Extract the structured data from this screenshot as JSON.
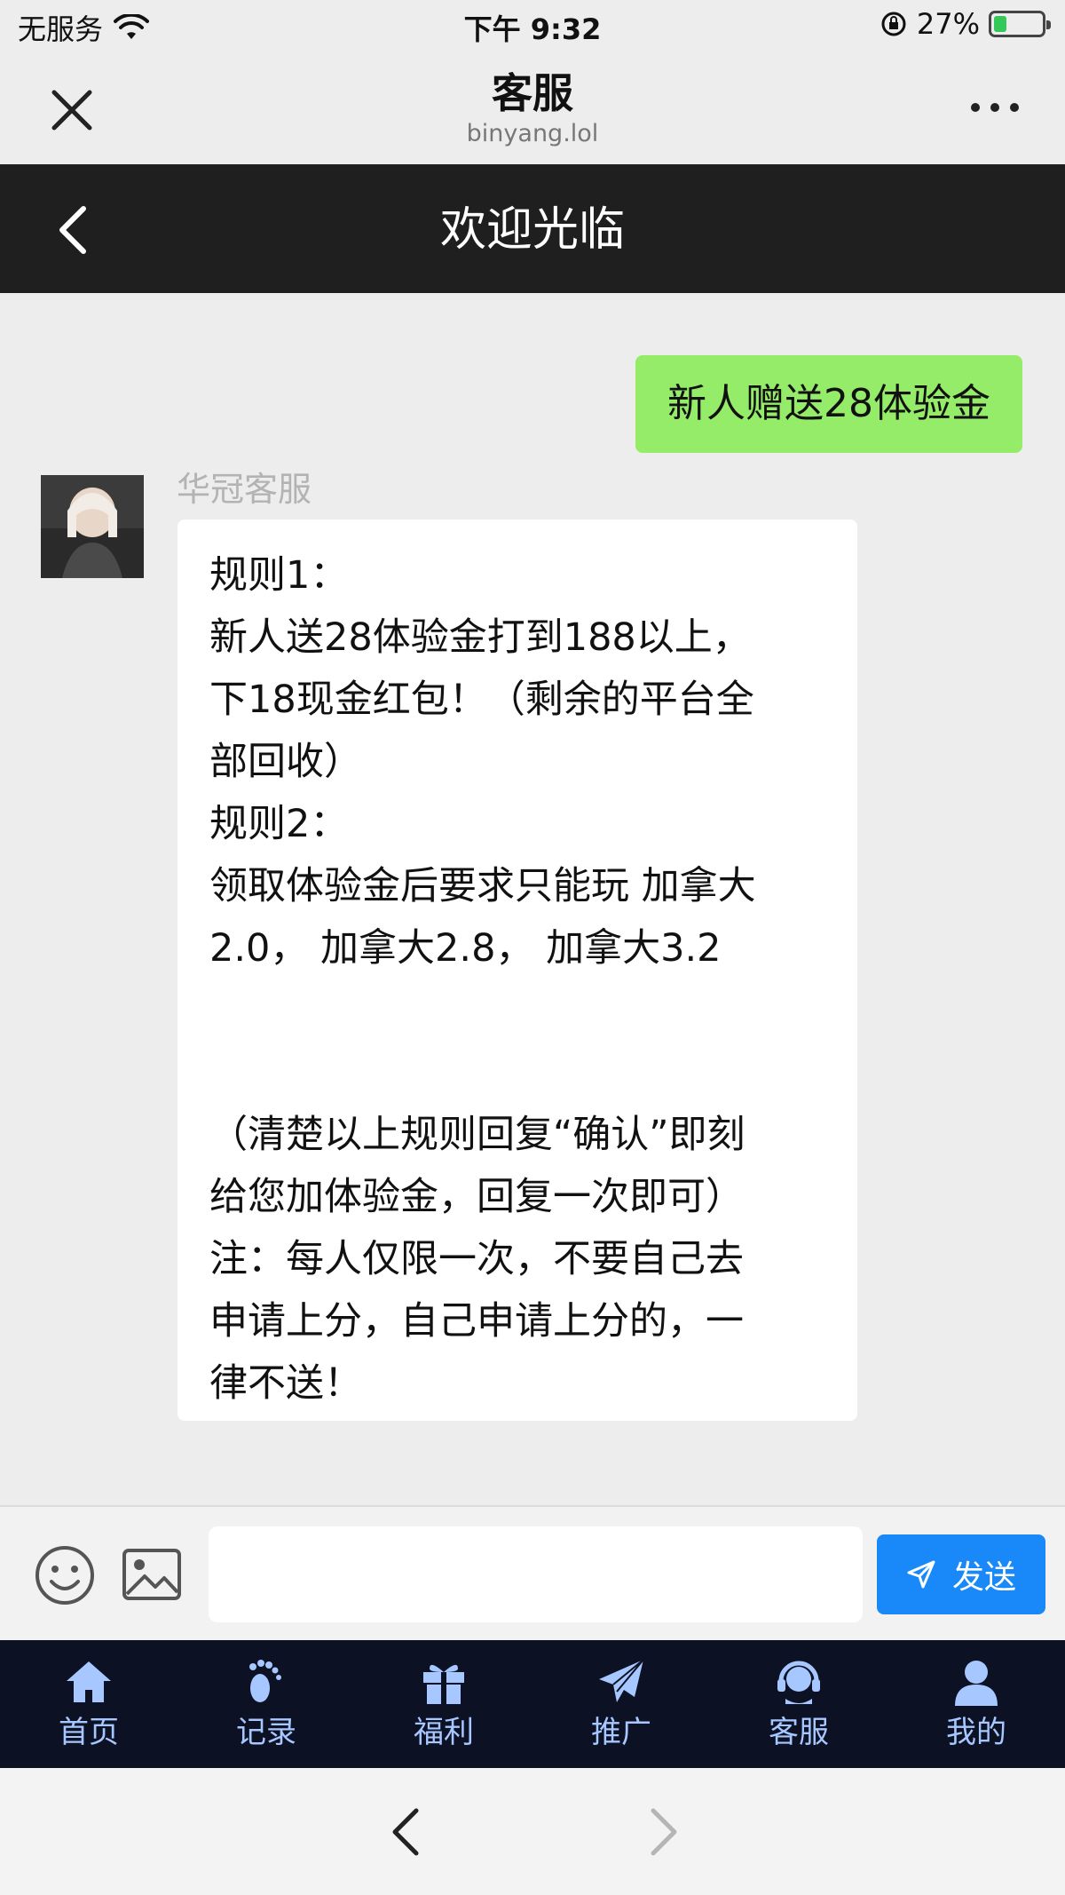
{
  "status_bar": {
    "carrier": "无服务",
    "time": "下午 9:32",
    "battery_percent": "27%",
    "battery_level": 0.27,
    "icons": [
      "wifi-icon",
      "orientation-lock-icon",
      "battery-charging-icon"
    ]
  },
  "nav": {
    "title": "客服",
    "subtitle": "binyang.lol",
    "icons": [
      "close-icon",
      "more-icon"
    ]
  },
  "page_header": {
    "title": "欢迎光临",
    "icons": [
      "back-icon"
    ]
  },
  "chat": {
    "outgoing_message": "新人赠送28体验金",
    "sender_name": "华冠客服",
    "incoming_lines": [
      "规则1：",
      "新人送28体验金打到188以上，",
      "下18现金红包！（剩余的平台全",
      "部回收）",
      "规则2：",
      "领取体验金后要求只能玩 加拿大",
      "2.0， 加拿大2.8， 加拿大3.2",
      "",
      "",
      "（清楚以上规则回复“确认”即刻",
      "给您加体验金，回复一次即可）",
      "注：每人仅限一次，不要自己去",
      "申请上分，自己申请上分的，一",
      "律不送！"
    ],
    "colors": {
      "outgoing_bubble": "#95ec69",
      "incoming_bubble": "#ffffff",
      "background": "#ededed"
    }
  },
  "input_bar": {
    "value": "",
    "send_label": "发送",
    "icons": [
      "emoji-icon",
      "image-icon",
      "send-icon"
    ],
    "send_color": "#1989fa"
  },
  "tabbar": {
    "background": "#0d1124",
    "accent": "#a6c7ff",
    "tabs": [
      {
        "label": "首页",
        "icon": "home-icon"
      },
      {
        "label": "记录",
        "icon": "footprint-icon"
      },
      {
        "label": "福利",
        "icon": "gift-icon"
      },
      {
        "label": "推广",
        "icon": "paper-plane-icon"
      },
      {
        "label": "客服",
        "icon": "headset-icon"
      },
      {
        "label": "我的",
        "icon": "user-icon"
      }
    ]
  },
  "browser_bar": {
    "icons": [
      "browser-back-icon",
      "browser-forward-icon"
    ]
  }
}
